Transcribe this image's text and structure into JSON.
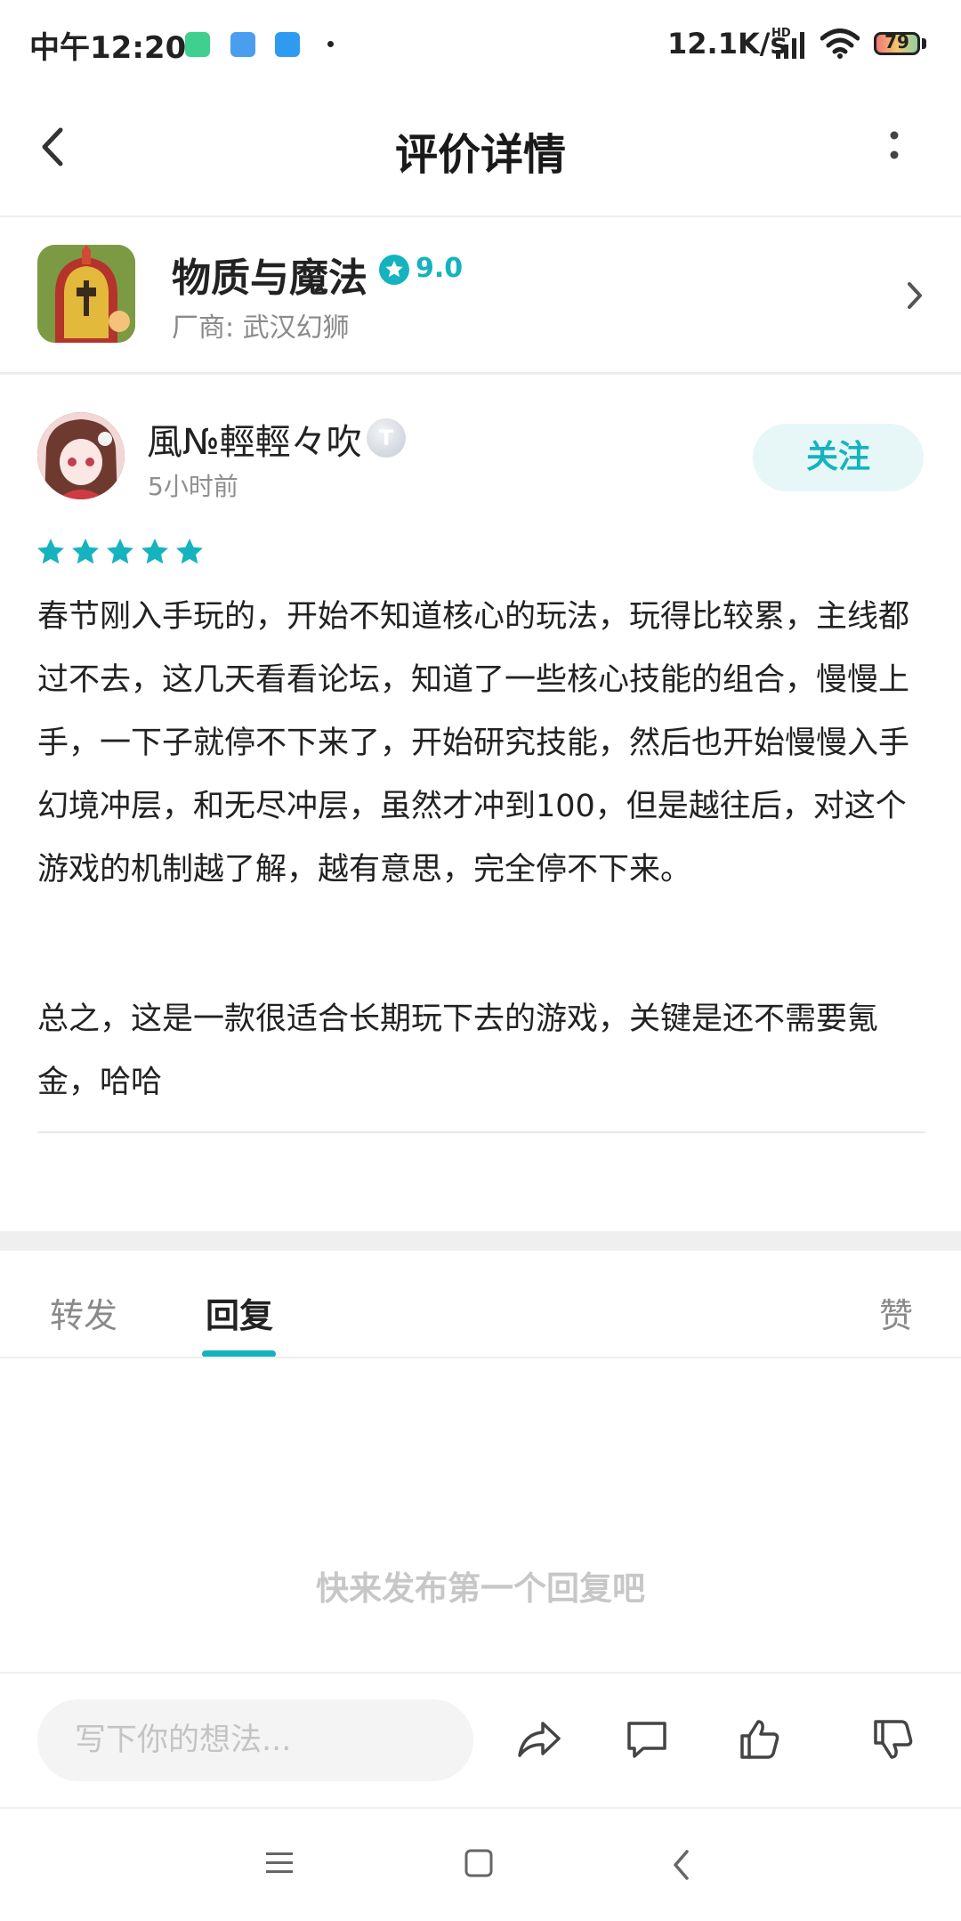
{
  "status_bar": {
    "time": "中午12:20",
    "net_speed": "12.1K/s",
    "hd_label": "HD",
    "battery": "79"
  },
  "header": {
    "title": "评价详情"
  },
  "game": {
    "name": "物质与魔法",
    "rating": "9.0",
    "vendor": "厂商: 武汉幻狮"
  },
  "review": {
    "username": "風№輕輕々吹",
    "level_badge": "T",
    "time": "5小时前",
    "follow_label": "关注",
    "stars": 5,
    "paragraphs": [
      "春节刚入手玩的，开始不知道核心的玩法，玩得比较累，主线都过不去，这几天看看论坛，知道了一些核心技能的组合，慢慢上手，一下子就停不下来了，开始研究技能，然后也开始慢慢入手幻境冲层，和无尽冲层，虽然才冲到100，但是越往后，对这个游戏的机制越了解，越有意思，完全停不下来。",
      "总之，这是一款很适合长期玩下去的游戏，关键是还不需要氪金，哈哈"
    ]
  },
  "tabs": [
    {
      "label": "转发",
      "active": false
    },
    {
      "label": "回复",
      "active": true
    },
    {
      "label": "赞",
      "active": false
    }
  ],
  "replies": {
    "empty_text": "快来发布第一个回复吧"
  },
  "comment_bar": {
    "placeholder": "写下你的想法..."
  },
  "colors": {
    "accent": "#15b3bd",
    "muted_text": "#8a8a8a"
  },
  "icons": [
    "back-arrow-icon",
    "more-vertical-icon",
    "star-badge-icon",
    "chevron-right-icon",
    "share-icon",
    "comment-icon",
    "thumb-up-icon",
    "thumb-down-icon",
    "menu-icon",
    "home-icon",
    "back-icon"
  ]
}
